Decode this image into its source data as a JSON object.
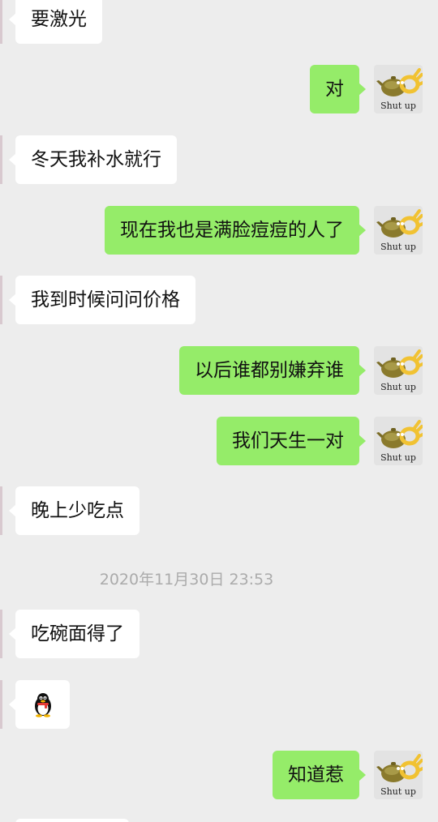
{
  "messages": [
    {
      "side": "in",
      "text": "要激光"
    },
    {
      "side": "out",
      "text": "对",
      "avatar_caption": "Shut up"
    },
    {
      "side": "in",
      "text": "冬天我补水就行"
    },
    {
      "side": "out",
      "text": "现在我也是满脸痘痘的人了",
      "avatar_caption": "Shut up"
    },
    {
      "side": "in",
      "text": "我到时候问问价格"
    },
    {
      "side": "out",
      "text": "以后谁都别嫌弃谁",
      "avatar_caption": "Shut up"
    },
    {
      "side": "out",
      "text": "我们天生一对",
      "avatar_caption": "Shut up"
    },
    {
      "side": "in",
      "text": "晚上少吃点"
    },
    {
      "side": "in",
      "text": "吃碗面得了"
    },
    {
      "side": "in",
      "emoji": "penguin-icon"
    },
    {
      "side": "out",
      "text": "知道惹",
      "avatar_caption": "Shut up"
    }
  ],
  "timestamp": "2020年11月30日 23:53",
  "colors": {
    "background": "#ededed",
    "incoming_bubble": "#ffffff",
    "outgoing_bubble": "#95ec69",
    "timestamp_text": "#ababab"
  }
}
